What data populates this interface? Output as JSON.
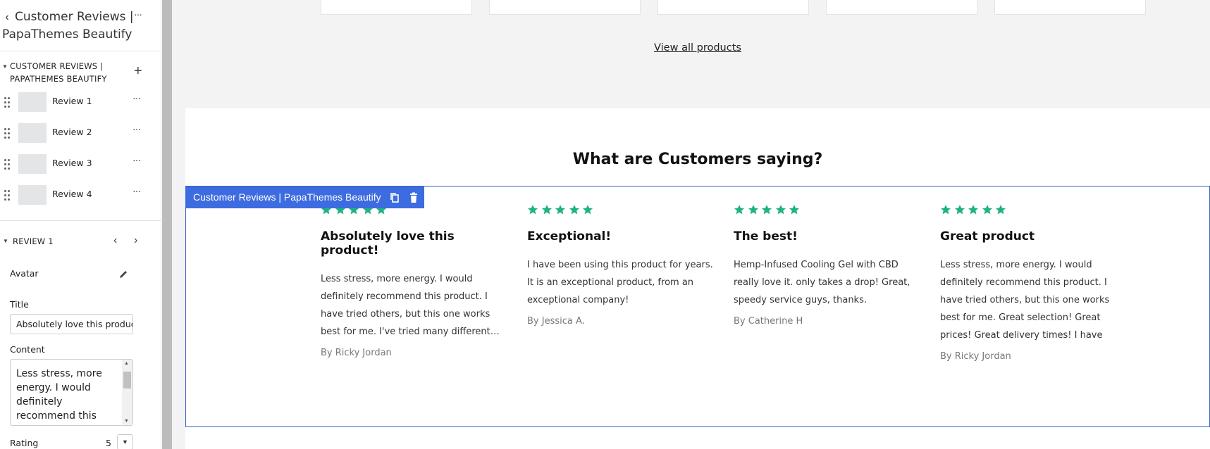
{
  "sidebar": {
    "title": "Customer Reviews | PapaThemes Beautify",
    "back_icon": "chevron-left-icon",
    "more_icon": "more-horizontal-icon",
    "section_title": "CUSTOMER REVIEWS | PAPATHEMES BEAUTIFY",
    "add_icon": "plus-icon",
    "blocks": [
      {
        "label": "Review 1"
      },
      {
        "label": "Review 2"
      },
      {
        "label": "Review 3"
      },
      {
        "label": "Review 4"
      }
    ],
    "review_section_title": "REVIEW 1",
    "fields": {
      "avatar_label": "Avatar",
      "title_label": "Title",
      "title_value": "Absolutely love this product!",
      "content_label": "Content",
      "content_value": "Less stress, more energy. I would definitely recommend this product. I have tried others, but this one works best for me.",
      "rating_label": "Rating",
      "rating_value": "5"
    }
  },
  "preview": {
    "view_all_label": "View all products",
    "heading": "What are Customers saying?",
    "editor_tag_label": "Customer Reviews | PapaThemes Beautify",
    "star_color": "#1fb37e",
    "accent_color": "#3d6ce0",
    "reviews": [
      {
        "rating": 5,
        "title": "Absolutely love this product!",
        "content": "Less stress, more energy. I would definitely recommend this product. I have tried others, but this one works best for me. I've tried many different brands of CBD and this has ...",
        "author": "By Ricky Jordan"
      },
      {
        "rating": 5,
        "title": "Exceptional!",
        "content": "I have been using this product for years. It is an exceptional product, from an exceptional company!",
        "author": "By Jessica A."
      },
      {
        "rating": 5,
        "title": "The best!",
        "content": "Hemp-Infused Cooling Gel with CBD really love it. only takes a drop! Great, speedy service guys, thanks.",
        "author": "By Catherine H"
      },
      {
        "rating": 5,
        "title": "Great product",
        "content": "Less stress, more energy. I would definitely recommend this product. I have tried others, but this one works best for me. Great selection! Great prices! Great delivery times! I have",
        "author": "By Ricky Jordan"
      }
    ]
  }
}
